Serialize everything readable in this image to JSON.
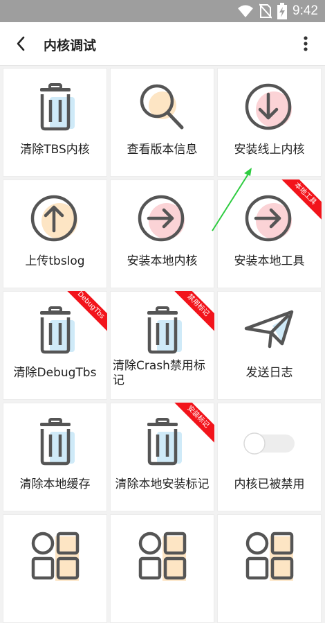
{
  "status_bar": {
    "time": "9:42"
  },
  "app_bar": {
    "title": "内核调试"
  },
  "tiles": [
    {
      "label": "清除TBS内核",
      "icon": "trash-icon",
      "ribbon": ""
    },
    {
      "label": "查看版本信息",
      "icon": "magnifier-icon",
      "ribbon": ""
    },
    {
      "label": "安装线上内核",
      "icon": "download-circle-icon",
      "ribbon": ""
    },
    {
      "label": "上传tbslog",
      "icon": "upload-circle-icon",
      "ribbon": ""
    },
    {
      "label": "安装本地内核",
      "icon": "arrow-right-circle-icon",
      "ribbon": ""
    },
    {
      "label": "安装本地工具",
      "icon": "arrow-right-circle-icon",
      "ribbon": "本地工具"
    },
    {
      "label": "清除DebugTbs",
      "icon": "trash-icon",
      "ribbon": "DebugTbs"
    },
    {
      "label": "清除Crash禁用标记",
      "icon": "trash-icon",
      "ribbon": "禁用标记"
    },
    {
      "label": "发送日志",
      "icon": "paper-plane-icon",
      "ribbon": ""
    },
    {
      "label": "清除本地缓存",
      "icon": "trash-icon",
      "ribbon": ""
    },
    {
      "label": "清除本地安装标记",
      "icon": "trash-icon",
      "ribbon": "安装标记"
    },
    {
      "label": "内核已被禁用",
      "icon": "toggle-switch-icon",
      "ribbon": ""
    },
    {
      "label": "",
      "icon": "apps-grid-icon",
      "ribbon": ""
    },
    {
      "label": "",
      "icon": "apps-grid-icon",
      "ribbon": ""
    },
    {
      "label": "",
      "icon": "apps-grid-icon",
      "ribbon": ""
    }
  ],
  "colors": {
    "status_bar": "#9e9e9e",
    "ribbon": "#f2141b",
    "icon_stroke": "#555555",
    "accent_blue": "#cfeaf8",
    "accent_orange": "#fde5c4",
    "accent_pink": "#fbd3d6",
    "annotation_arrow": "#2ecc40"
  }
}
